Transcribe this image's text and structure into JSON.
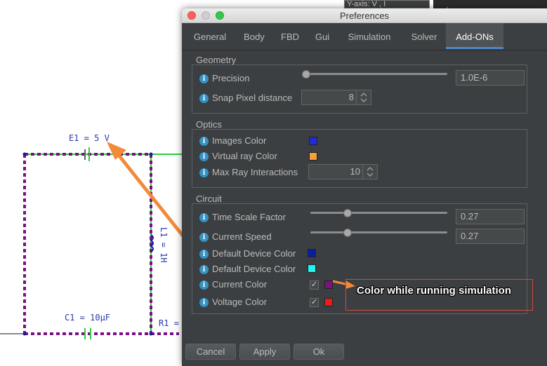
{
  "window": {
    "title": "Preferences"
  },
  "tabs": [
    "General",
    "Body",
    "FBD",
    "Gui",
    "Simulation",
    "Solver",
    "Add-ONs"
  ],
  "active_tab": "Add-ONs",
  "geometry": {
    "title": "Geometry",
    "precision": {
      "label": "Precision",
      "value": "1.0E-6",
      "slider_fraction": 0.0
    },
    "snap": {
      "label": "Snap Pixel distance",
      "value": "8"
    }
  },
  "optics": {
    "title": "Optics",
    "images_color": {
      "label": "Images Color",
      "color": "#1f2bd6"
    },
    "virtual_ray_color": {
      "label": "Virtual ray Color",
      "color": "#f5a03a"
    },
    "max_ray": {
      "label": "Max Ray Interactions",
      "value": "10"
    }
  },
  "circuit": {
    "title": "Circuit",
    "time_scale": {
      "label": "Time Scale Factor",
      "value": "0.27",
      "slider_fraction": 0.27
    },
    "current_speed": {
      "label": "Current Speed",
      "value": "0.27",
      "slider_fraction": 0.27
    },
    "default_device_color_1": {
      "label": "Default Device Color",
      "color": "#0a1f9e"
    },
    "default_device_color_2": {
      "label": "Default Device Color",
      "color": "#1ff5f0"
    },
    "current_color": {
      "label": "Current Color",
      "checked": true,
      "color": "#7a1282"
    },
    "voltage_color": {
      "label": "Voltage Color",
      "checked": true,
      "color": "#f01a1a"
    }
  },
  "callout": {
    "text": "Color while running simulation"
  },
  "buttons": {
    "cancel": "Cancel",
    "apply": "Apply",
    "ok": "Ok"
  },
  "background": {
    "e1_label": "E1 = 5 V",
    "l1_label": "L1 = 1H",
    "c1_label": "C1 = 10μF",
    "r1_label": "R1 =",
    "yaxis_text": "Y-axis: V , I"
  },
  "colors": {
    "wire": "#2ecc40",
    "current": "#7a1282",
    "arrow": "#f28a3a",
    "callout_border": "#d24a3a"
  },
  "icons": {
    "info": "info-icon",
    "check": "check-icon",
    "spinner": "spinner-arrows-icon"
  }
}
